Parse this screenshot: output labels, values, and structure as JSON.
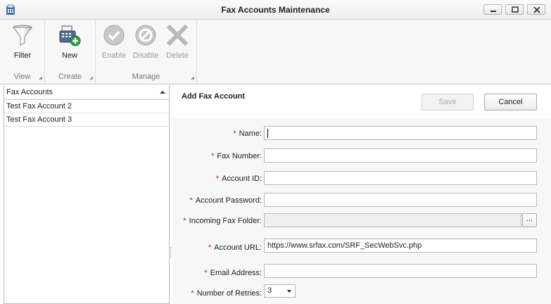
{
  "window": {
    "title": "Fax Accounts Maintenance"
  },
  "ribbon": {
    "groups": {
      "view": "View",
      "create": "Create",
      "manage": "Manage"
    },
    "buttons": {
      "filter": "Filter",
      "new": "New",
      "enable": "Enable",
      "disable": "Disable",
      "delete": "Delete"
    }
  },
  "list": {
    "header": "Fax Accounts",
    "items": [
      "Test Fax Account 2",
      "Test Fax Account 3"
    ]
  },
  "form": {
    "title": "Add Fax Account",
    "save_label": "Save",
    "cancel_label": "Cancel",
    "required_marker": "*",
    "fields": {
      "name": {
        "label": "Name:",
        "value": ""
      },
      "fax_number": {
        "label": "Fax Number:",
        "value": ""
      },
      "account_id": {
        "label": "Account ID:",
        "value": ""
      },
      "account_password": {
        "label": "Account Password:",
        "value": ""
      },
      "incoming_fax_folder": {
        "label": "Incoming Fax Folder:",
        "value": "",
        "browse_label": "..."
      },
      "account_url": {
        "label": "Account URL:",
        "value": "https://www.srfax.com/SRF_SecWebSvc.php"
      },
      "email_address": {
        "label": "Email Address:",
        "value": ""
      },
      "number_of_retries": {
        "label": "Number of Retries:",
        "value": "3"
      }
    }
  },
  "colors": {
    "required": "#cc1111",
    "form_background": "#f7f7f7",
    "ribbon_background": "#f7f7f7"
  }
}
